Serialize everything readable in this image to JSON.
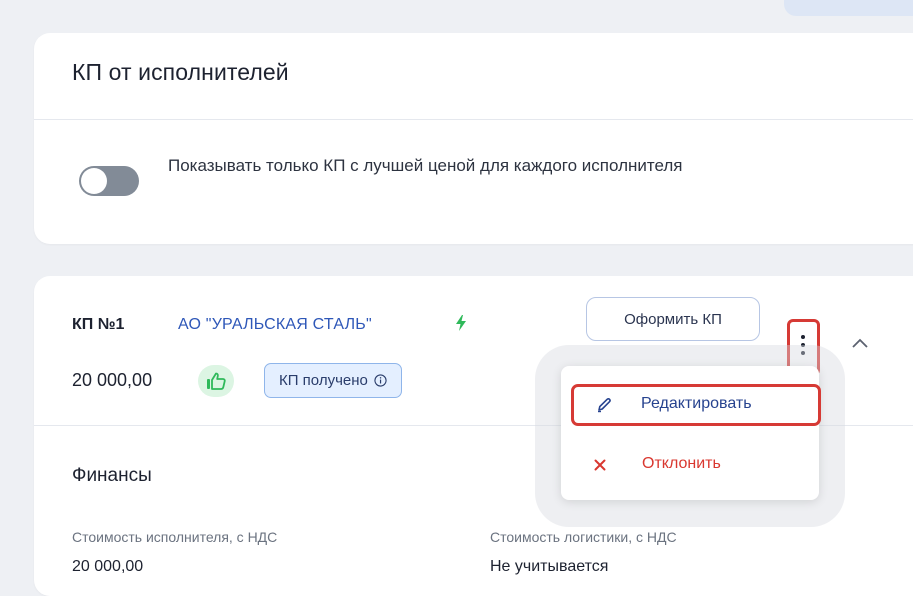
{
  "offers_card": {
    "title": "КП от исполнителей",
    "toggle_label": "Показывать только КП с лучшей ценой для каждого исполнителя",
    "toggle_on": false
  },
  "offer": {
    "number": "КП №1",
    "supplier": "АО \"УРАЛЬСКАЯ СТАЛЬ\"",
    "supplier_icon": "lightning-icon",
    "issue_button": "Оформить КП",
    "price": "20 000,00",
    "like_icon": "thumbs-up-icon",
    "status": "КП получено",
    "status_icon": "info-icon"
  },
  "finance": {
    "title": "Финансы",
    "fields": [
      {
        "label": "Стоимость исполнителя, с НДС",
        "value": "20 000,00"
      },
      {
        "label": "Стоимость логистики, с НДС",
        "value": "Не учитывается"
      }
    ]
  },
  "context_menu": {
    "items": [
      {
        "label": "Редактировать",
        "icon": "pencil-icon"
      },
      {
        "label": "Отклонить",
        "icon": "close-icon"
      }
    ]
  },
  "colors": {
    "accent_blue": "#2e57b8",
    "danger_red": "#d9372f",
    "highlight_red": "#d63a35",
    "like_green": "#2fb95a",
    "toggle_gray": "#828b97"
  }
}
